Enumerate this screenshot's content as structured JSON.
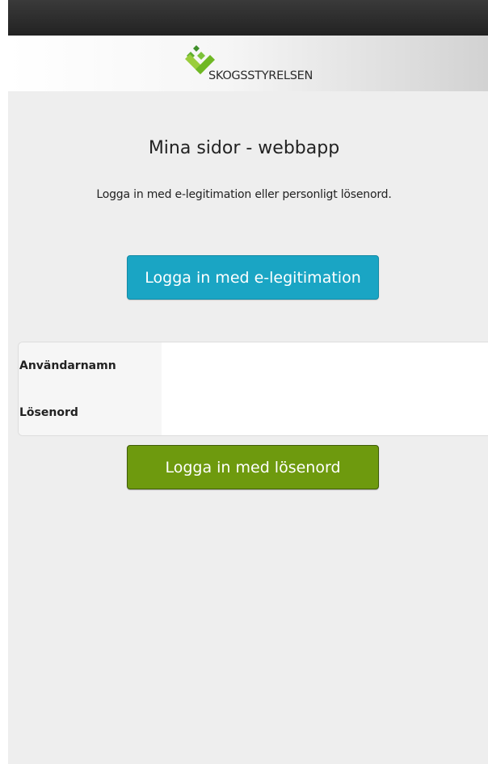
{
  "header": {
    "logo_text": "SKOGSSTYRELSEN",
    "brand_color": "#6FB824"
  },
  "main": {
    "title": "Mina sidor - webbapp",
    "intro": "Logga in med e-legitimation eller personligt lösenord.",
    "eid_button_label": "Logga in med e-legitimation",
    "eid_button_color": "#1AA5C4"
  },
  "form": {
    "username_label": "Användarnamn",
    "username_value": "",
    "password_label": "Lösenord",
    "password_value": "",
    "submit_label": "Logga in med lösenord",
    "submit_color": "#6E9A0E"
  }
}
